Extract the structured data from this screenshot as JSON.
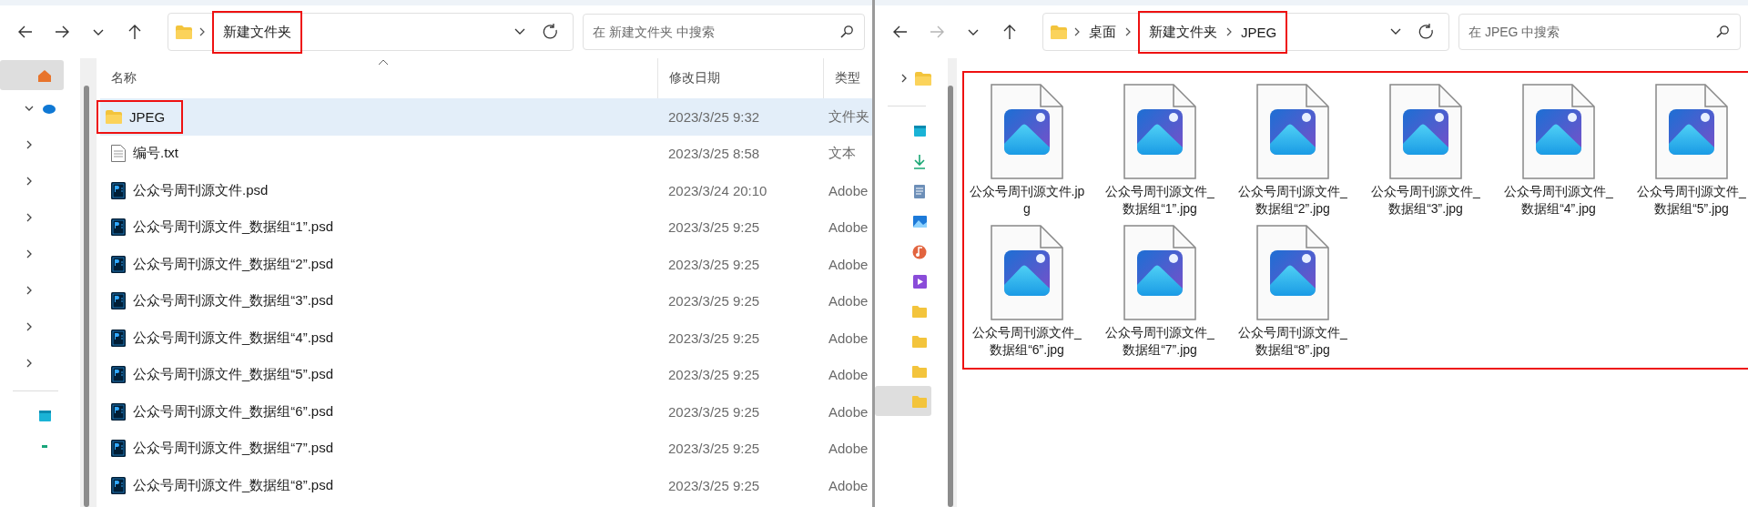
{
  "windows": [
    {
      "nav_buttons": [
        {
          "kind": "back",
          "disabled": false
        },
        {
          "kind": "forward",
          "disabled": false
        },
        {
          "kind": "recent",
          "disabled": false
        },
        {
          "kind": "up",
          "disabled": false
        }
      ],
      "address": {
        "segments": [
          {
            "label": "新建文件夹",
            "annotated": true
          }
        ]
      },
      "search": {
        "placeholder": "在 新建文件夹 中搜索"
      },
      "nav_pane": [
        {
          "kind": "home",
          "selected": true
        },
        {
          "kind": "cloud",
          "expanded": true,
          "selected": false
        },
        {
          "kind": "expander",
          "expanded": false,
          "selected": false
        },
        {
          "kind": "expander",
          "expanded": false,
          "selected": false
        },
        {
          "kind": "expander",
          "expanded": false,
          "selected": false
        },
        {
          "kind": "expander",
          "expanded": false,
          "selected": false
        },
        {
          "kind": "expander",
          "expanded": false,
          "selected": false
        },
        {
          "kind": "expander",
          "expanded": false,
          "selected": false
        },
        {
          "kind": "expander",
          "expanded": false,
          "selected": false
        },
        {
          "kind": "divider"
        },
        {
          "kind": "desktop",
          "selected": false
        },
        {
          "kind": "dash",
          "selected": false
        }
      ],
      "view": {
        "kind": "details",
        "columns": [
          "名称",
          "修改日期",
          "类型"
        ],
        "rows": [
          {
            "kind": "folder",
            "name": "JPEG",
            "date": "2023/3/25 9:32",
            "type": "文件夹",
            "selected": true,
            "annotated": true
          },
          {
            "kind": "text",
            "name": "编号.txt",
            "date": "2023/3/25 8:58",
            "type": "文本",
            "selected": false,
            "annotated": false
          },
          {
            "kind": "psd",
            "name": "公众号周刊源文件.psd",
            "date": "2023/3/24 20:10",
            "type": "Adobe",
            "selected": false,
            "annotated": false
          },
          {
            "kind": "psd",
            "name": "公众号周刊源文件_数据组“1”.psd",
            "date": "2023/3/25 9:25",
            "type": "Adobe",
            "selected": false,
            "annotated": false
          },
          {
            "kind": "psd",
            "name": "公众号周刊源文件_数据组“2”.psd",
            "date": "2023/3/25 9:25",
            "type": "Adobe",
            "selected": false,
            "annotated": false
          },
          {
            "kind": "psd",
            "name": "公众号周刊源文件_数据组“3”.psd",
            "date": "2023/3/25 9:25",
            "type": "Adobe",
            "selected": false,
            "annotated": false
          },
          {
            "kind": "psd",
            "name": "公众号周刊源文件_数据组“4”.psd",
            "date": "2023/3/25 9:25",
            "type": "Adobe",
            "selected": false,
            "annotated": false
          },
          {
            "kind": "psd",
            "name": "公众号周刊源文件_数据组“5”.psd",
            "date": "2023/3/25 9:25",
            "type": "Adobe",
            "selected": false,
            "annotated": false
          },
          {
            "kind": "psd",
            "name": "公众号周刊源文件_数据组“6”.psd",
            "date": "2023/3/25 9:25",
            "type": "Adobe",
            "selected": false,
            "annotated": false
          },
          {
            "kind": "psd",
            "name": "公众号周刊源文件_数据组“7”.psd",
            "date": "2023/3/25 9:25",
            "type": "Adobe",
            "selected": false,
            "annotated": false
          },
          {
            "kind": "psd",
            "name": "公众号周刊源文件_数据组“8”.psd",
            "date": "2023/3/25 9:25",
            "type": "Adobe",
            "selected": false,
            "annotated": false
          }
        ]
      }
    },
    {
      "nav_buttons": [
        {
          "kind": "back",
          "disabled": false
        },
        {
          "kind": "forward",
          "disabled": true
        },
        {
          "kind": "recent",
          "disabled": false
        },
        {
          "kind": "up",
          "disabled": false
        }
      ],
      "address": {
        "segments": [
          {
            "label": "桌面",
            "annotated": false
          },
          {
            "label": "新建文件夹",
            "annotated": true
          },
          {
            "label": "JPEG",
            "annotated": true
          }
        ]
      },
      "search": {
        "placeholder": "在 JPEG 中搜索"
      },
      "nav_pane": [
        {
          "kind": "folder",
          "expanded": false,
          "selected": false
        },
        {
          "kind": "divider"
        },
        {
          "kind": "desktop",
          "selected": false
        },
        {
          "kind": "download",
          "selected": false
        },
        {
          "kind": "document",
          "selected": false
        },
        {
          "kind": "picture",
          "selected": false
        },
        {
          "kind": "music",
          "selected": false
        },
        {
          "kind": "video",
          "selected": false
        },
        {
          "kind": "folder-plain",
          "selected": false
        },
        {
          "kind": "folder-plain",
          "selected": false
        },
        {
          "kind": "folder-plain",
          "selected": false
        },
        {
          "kind": "folder-plain",
          "selected": true
        }
      ],
      "view": {
        "kind": "icons",
        "annotated": true,
        "items": [
          {
            "name": "公众号周刊源文件.jpg"
          },
          {
            "name": "公众号周刊源文件_数据组“1”.jpg"
          },
          {
            "name": "公众号周刊源文件_数据组“2”.jpg"
          },
          {
            "name": "公众号周刊源文件_数据组“3”.jpg"
          },
          {
            "name": "公众号周刊源文件_数据组“4”.jpg"
          },
          {
            "name": "公众号周刊源文件_数据组“5”.jpg"
          },
          {
            "name": "公众号周刊源文件_数据组“6”.jpg"
          },
          {
            "name": "公众号周刊源文件_数据组“7”.jpg"
          },
          {
            "name": "公众号周刊源文件_数据组“8”.jpg"
          }
        ]
      }
    }
  ]
}
